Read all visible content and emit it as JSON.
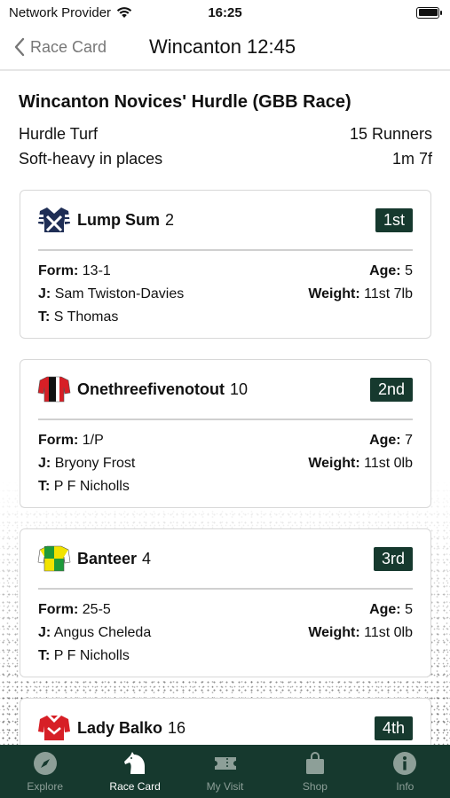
{
  "status_bar": {
    "carrier": "Network Provider",
    "time": "16:25"
  },
  "nav": {
    "back_label": "Race Card",
    "title": "Wincanton 12:45"
  },
  "race": {
    "title": "Wincanton Novices' Hurdle (GBB Race)",
    "type": "Hurdle Turf",
    "runners": "15 Runners",
    "going": "Soft-heavy in places",
    "distance": "1m 7f"
  },
  "labels": {
    "form": "Form:",
    "age": "Age:",
    "jockey": "J:",
    "weight": "Weight:",
    "trainer": "T:"
  },
  "results": [
    {
      "name": "Lump Sum",
      "number": "2",
      "position": "1st",
      "form": "13-1",
      "age": "5",
      "jockey": "Sam Twiston-Davies",
      "weight": "11st 7lb",
      "trainer": "S Thomas",
      "silk_icon": "navy-white-silk-icon"
    },
    {
      "name": "Onethreefivenotout",
      "number": "10",
      "position": "2nd",
      "form": "1/P",
      "age": "7",
      "jockey": "Bryony Frost",
      "weight": "11st 0lb",
      "trainer": "P F Nicholls",
      "silk_icon": "red-black-silk-icon"
    },
    {
      "name": "Banteer",
      "number": "4",
      "position": "3rd",
      "form": "25-5",
      "age": "5",
      "jockey": "Angus Cheleda",
      "weight": "11st 0lb",
      "trainer": "P F Nicholls",
      "silk_icon": "yellow-green-silk-icon"
    },
    {
      "name": "Lady Balko",
      "number": "16",
      "position": "4th",
      "silk_icon": "red-white-silk-icon"
    }
  ],
  "tabs": [
    {
      "label": "Explore",
      "icon": "compass-icon",
      "active": false
    },
    {
      "label": "Race Card",
      "icon": "horse-head-icon",
      "active": true
    },
    {
      "label": "My Visit",
      "icon": "ticket-icon",
      "active": false
    },
    {
      "label": "Shop",
      "icon": "shopping-bag-icon",
      "active": false
    },
    {
      "label": "Info",
      "icon": "info-icon",
      "active": false
    }
  ],
  "colors": {
    "accent": "#16392e",
    "tab_inactive": "#8d9f98"
  }
}
